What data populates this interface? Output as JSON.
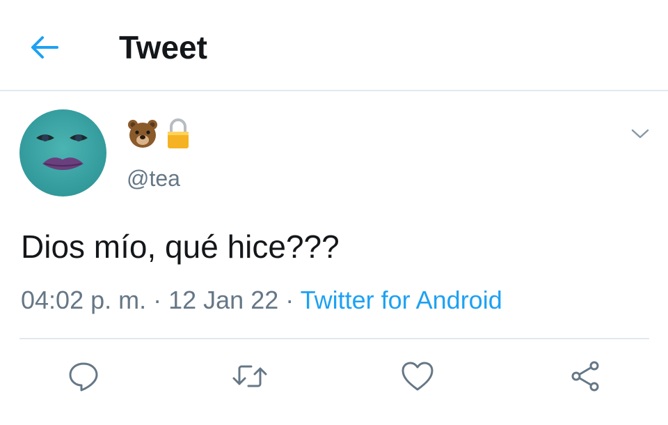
{
  "header": {
    "back_icon": "arrow-left-icon",
    "title": "Tweet",
    "accent_color": "#1da1f2"
  },
  "tweet": {
    "author": {
      "avatar": "teal-face-avatar",
      "display_name_emojis": [
        "bear-face-emoji",
        "lock-emoji"
      ],
      "handle": "@tea"
    },
    "menu_icon": "chevron-down-icon",
    "text": "Dios mío, qué hice???",
    "time": "04:02 p. m.",
    "separator": " · ",
    "date": "12 Jan 22",
    "source": "Twitter for Android"
  },
  "actions": [
    {
      "name": "reply",
      "icon": "reply-icon"
    },
    {
      "name": "retweet",
      "icon": "retweet-icon"
    },
    {
      "name": "like",
      "icon": "heart-icon"
    },
    {
      "name": "share",
      "icon": "share-icon"
    }
  ],
  "colors": {
    "text": "#14171a",
    "secondary": "#657786",
    "link": "#1da1f2",
    "border": "#e1e8ed",
    "avatar_bg": "#3aa7a8"
  }
}
